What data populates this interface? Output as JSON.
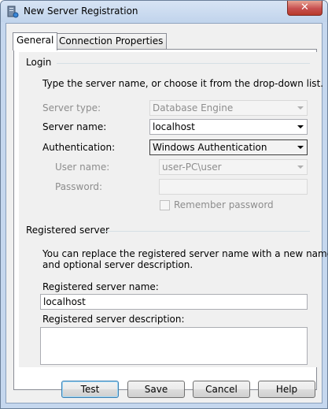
{
  "window": {
    "title": "New Server Registration",
    "close_symbol": "✕"
  },
  "tabs": [
    {
      "label": "General",
      "active": true
    },
    {
      "label": "Connection Properties",
      "active": false
    }
  ],
  "login": {
    "section_title": "Login",
    "instruction": "Type the server name, or choose it from the drop-down list.",
    "server_type_label": "Server type:",
    "server_type_value": "Database Engine",
    "server_name_label": "Server name:",
    "server_name_value": "localhost",
    "authentication_label": "Authentication:",
    "authentication_value": "Windows Authentication",
    "user_name_label": "User name:",
    "user_name_value": "user-PC\\user",
    "password_label": "Password:",
    "password_value": "",
    "remember_password_label": "Remember password"
  },
  "registered": {
    "section_title": "Registered server",
    "instruction_line1": "You can replace the registered server name with a new name",
    "instruction_line2": "and optional server description.",
    "name_label": "Registered server name:",
    "name_value": "localhost",
    "description_label": "Registered server description:",
    "description_value": ""
  },
  "buttons": {
    "test": "Test",
    "save": "Save",
    "cancel": "Cancel",
    "help": "Help"
  }
}
